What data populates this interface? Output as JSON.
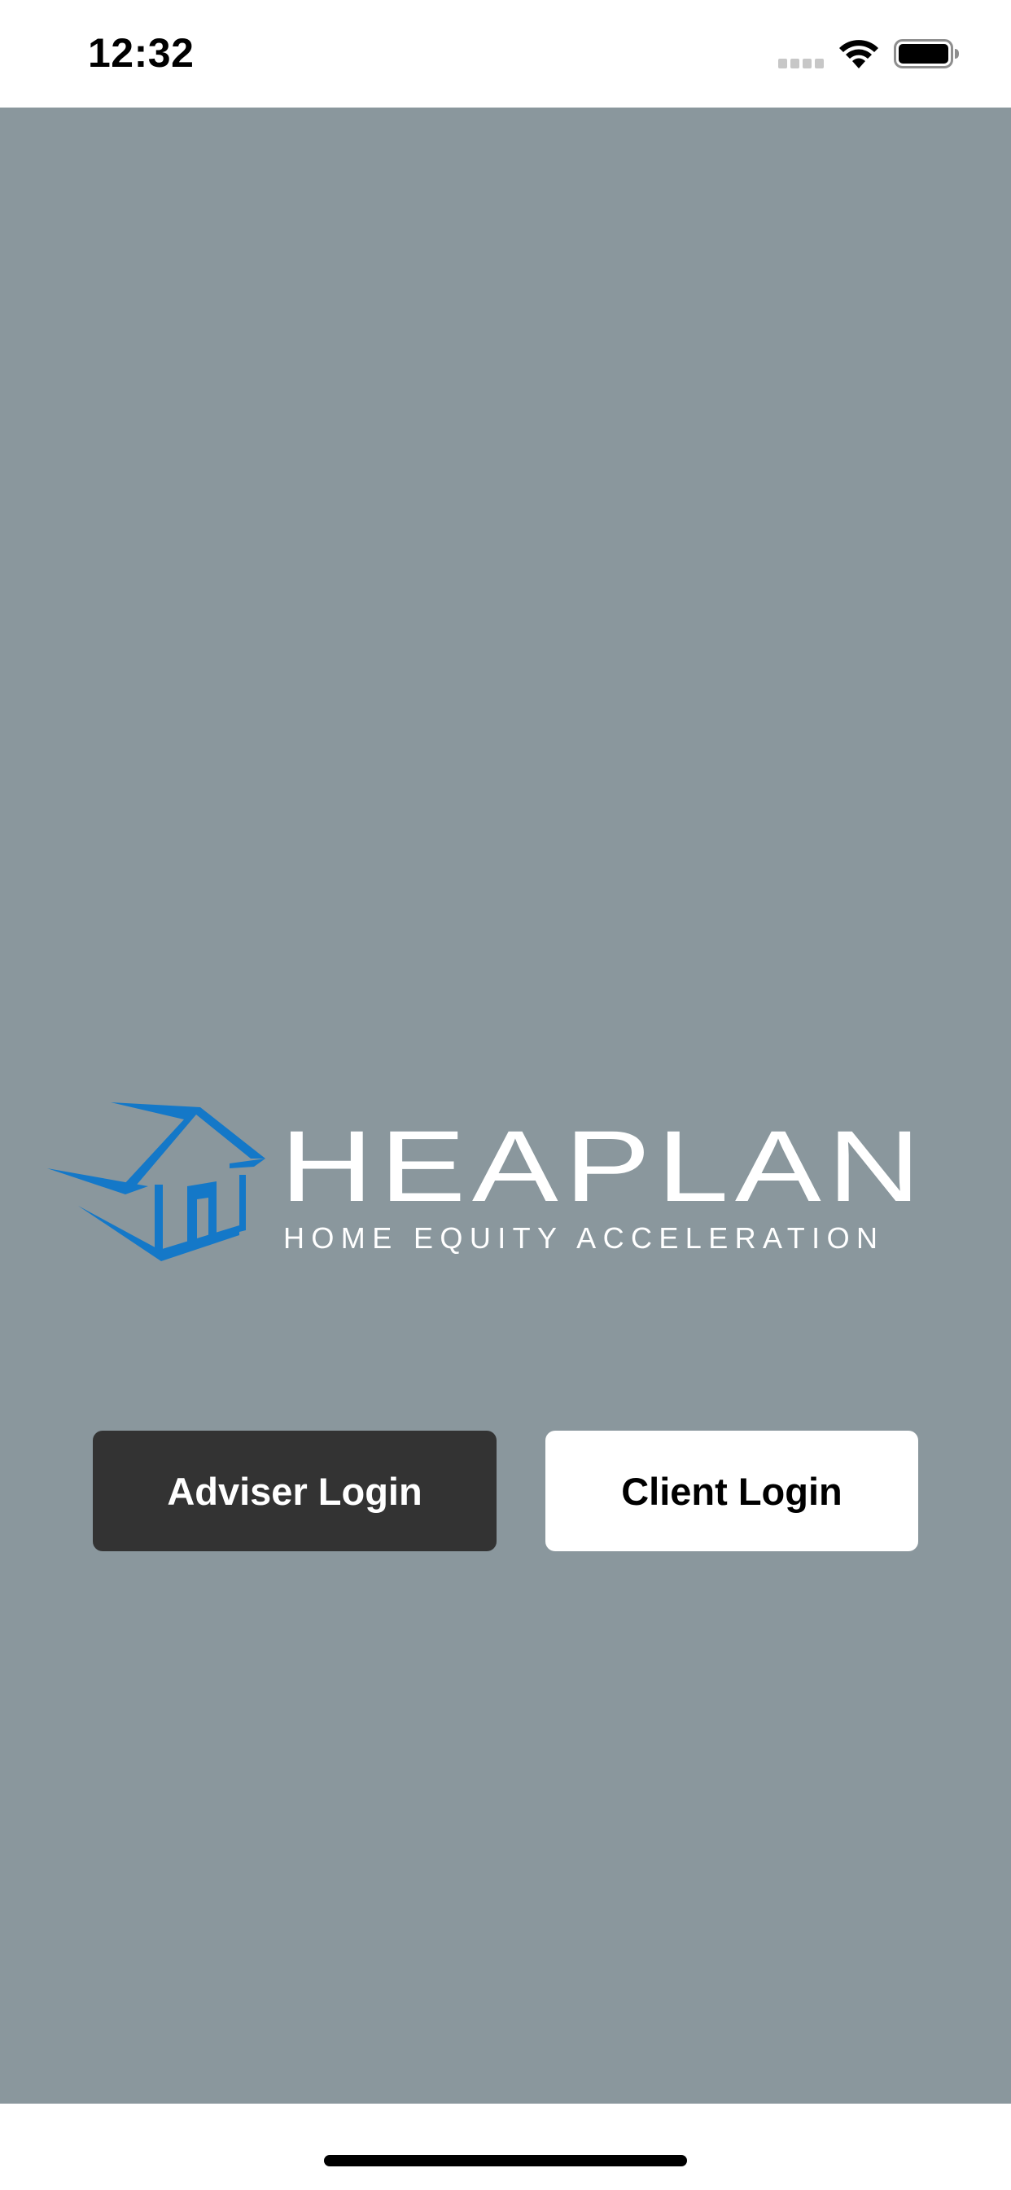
{
  "status_bar": {
    "time": "12:32",
    "icons": [
      "cellular-signal-icon",
      "wifi-icon",
      "battery-icon"
    ]
  },
  "logo": {
    "brand_name": "HEAPLAN",
    "tagline": "HOME EQUITY ACCELERATION",
    "icon": "house-logo-icon",
    "accent_color": "#1478c8"
  },
  "buttons": {
    "adviser_label": "Adviser Login",
    "client_label": "Client Login"
  },
  "colors": {
    "background": "#8a979d",
    "adviser_button": "#333333",
    "client_button": "#ffffff"
  }
}
